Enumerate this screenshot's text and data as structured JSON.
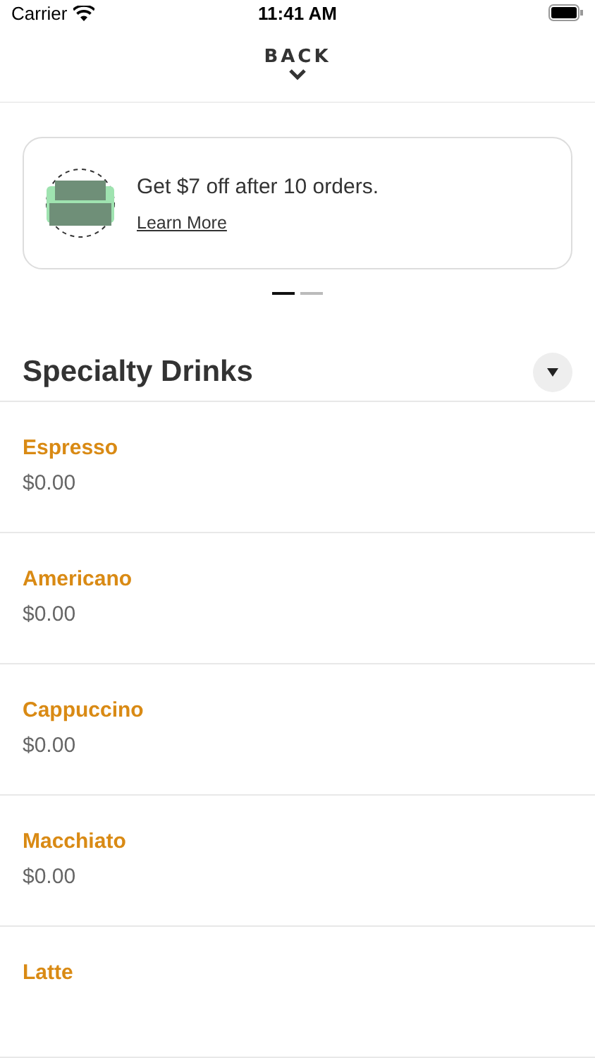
{
  "status_bar": {
    "carrier": "Carrier",
    "time": "11:41 AM"
  },
  "header": {
    "back": "BACK"
  },
  "promo": {
    "text": "Get $7 off after 10 orders.",
    "link": "Learn More"
  },
  "pager": [
    {
      "selected": true
    },
    {
      "selected": false
    }
  ],
  "section": {
    "title": "Specialty Drinks",
    "expanded": false
  },
  "items": [
    {
      "name": "Espresso",
      "price": "$0.00"
    },
    {
      "name": "Americano",
      "price": "$0.00"
    },
    {
      "name": "Cappuccino",
      "price": "$0.00"
    },
    {
      "name": "Macchiato",
      "price": "$0.00"
    },
    {
      "name": "Latte"
    }
  ]
}
